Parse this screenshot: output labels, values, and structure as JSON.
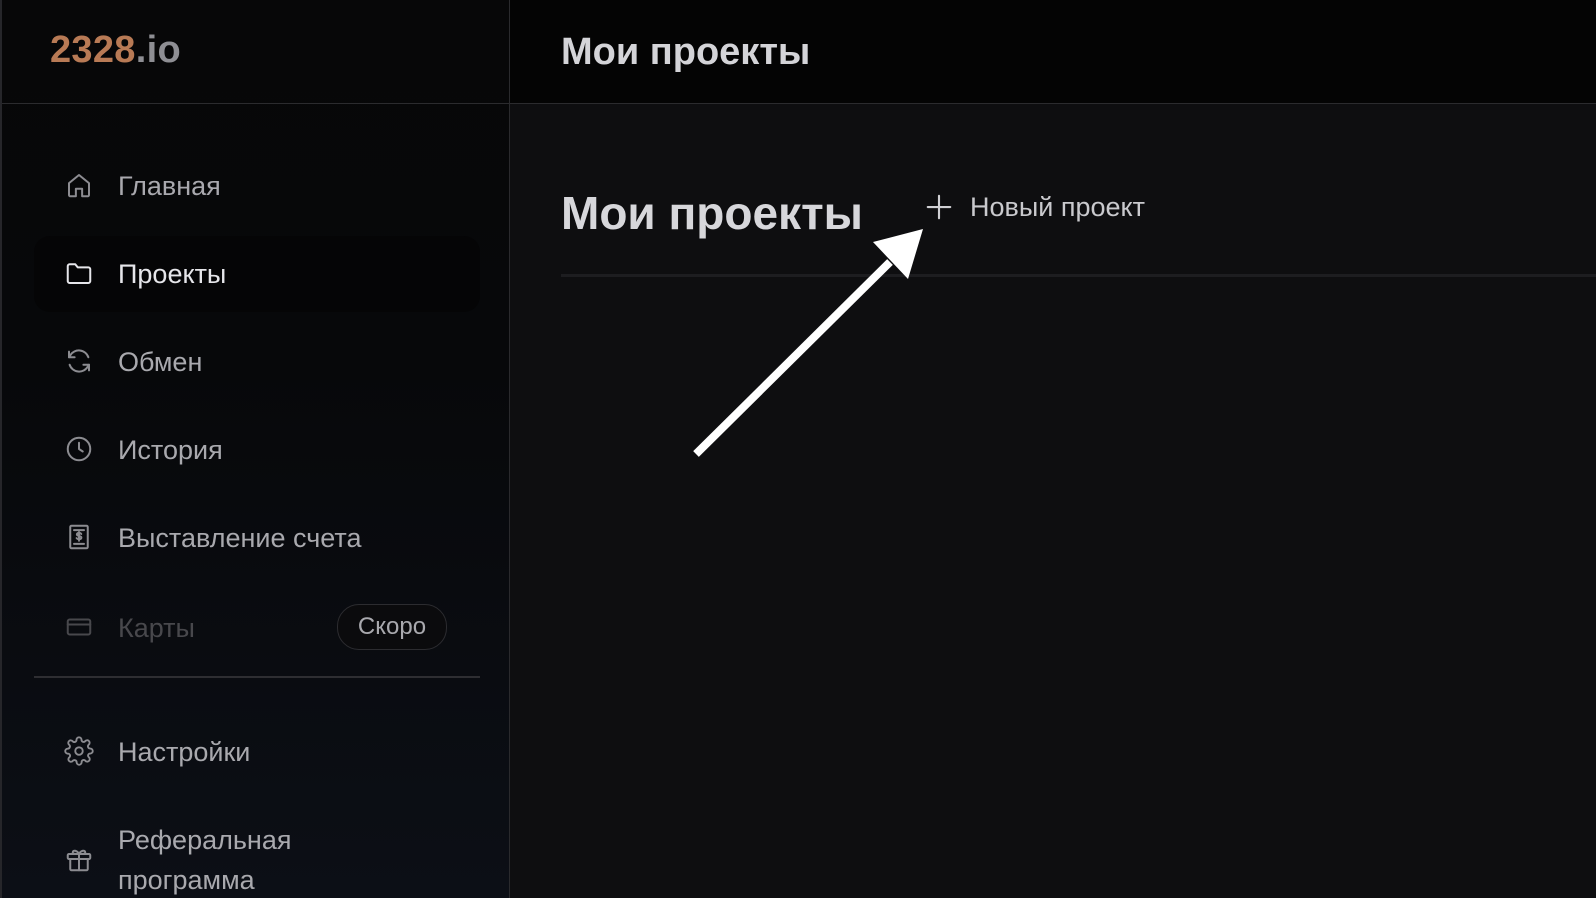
{
  "brand": {
    "logo_main": "2328",
    "logo_tld": ".io",
    "colors": {
      "logo_main": "#b87a55",
      "logo_tld": "#8e8e93"
    }
  },
  "sidebar": {
    "items": [
      {
        "label": "Главная",
        "icon": "home-icon",
        "state": "normal"
      },
      {
        "label": "Проекты",
        "icon": "folder-icon",
        "state": "active"
      },
      {
        "label": "Обмен",
        "icon": "refresh-icon",
        "state": "normal"
      },
      {
        "label": "История",
        "icon": "clock-icon",
        "state": "normal"
      },
      {
        "label": "Выставление счета",
        "icon": "receipt-icon",
        "state": "normal"
      },
      {
        "label": "Карты",
        "icon": "credit-card-icon",
        "state": "disabled",
        "badge": "Скоро"
      },
      {
        "label": "Настройки",
        "icon": "gear-icon",
        "state": "normal"
      },
      {
        "label": "Реферальная программа",
        "icon": "gift-icon",
        "state": "normal"
      }
    ]
  },
  "header": {
    "title": "Мои проекты"
  },
  "main": {
    "heading": "Мои проекты",
    "new_project_label": "Новый проект",
    "new_project_icon": "plus-icon"
  },
  "annotation": {
    "type": "arrow",
    "color": "#ffffff",
    "points_to": "new-project-button"
  }
}
